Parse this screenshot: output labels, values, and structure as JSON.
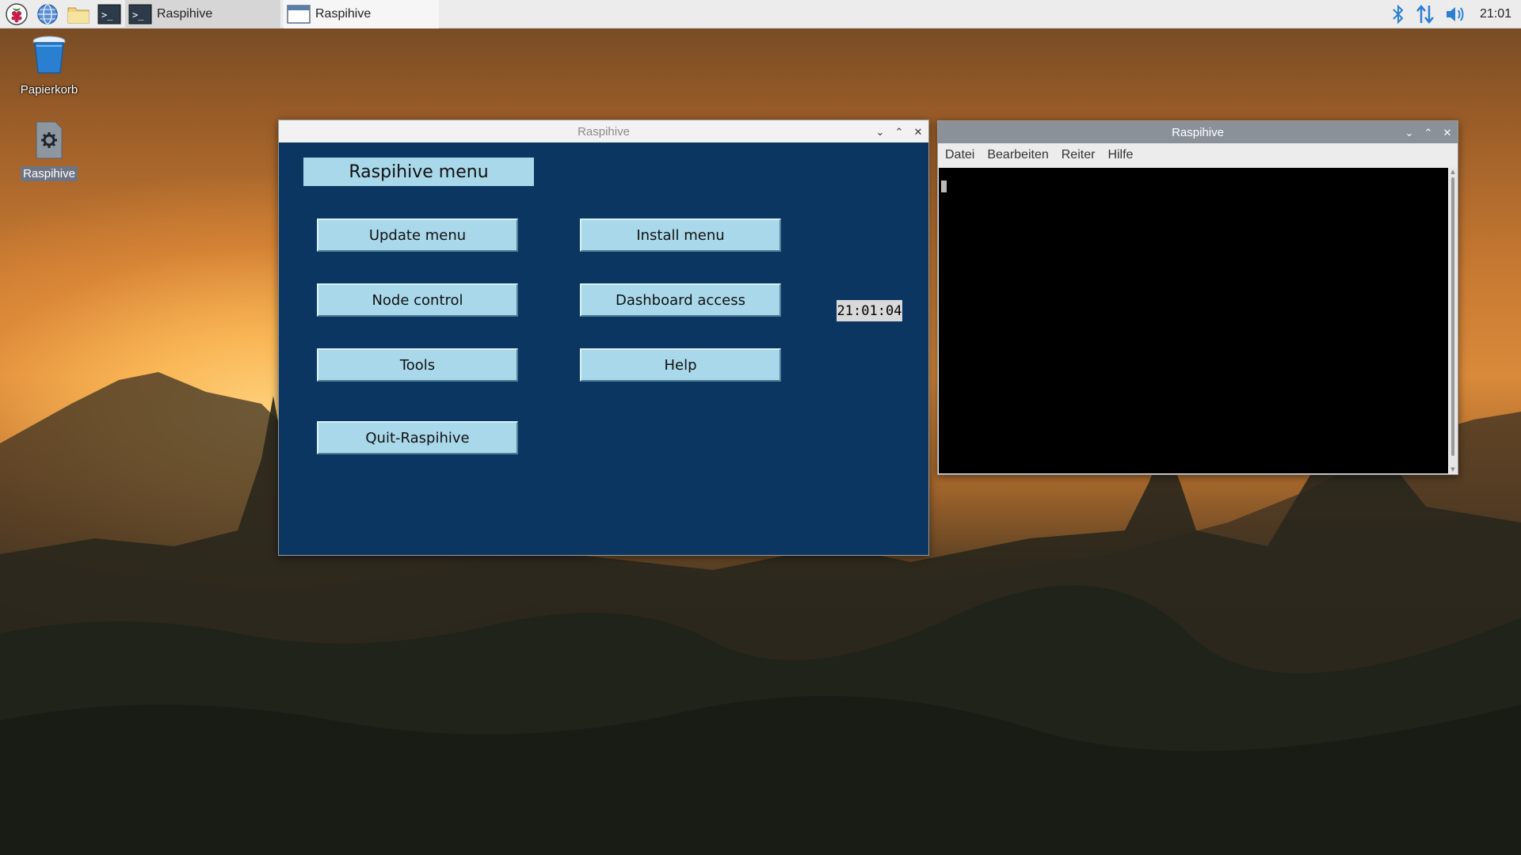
{
  "taskbar": {
    "launchers": [
      {
        "name": "raspberry-menu-icon"
      },
      {
        "name": "web-browser-icon"
      },
      {
        "name": "file-manager-icon"
      },
      {
        "name": "terminal-icon"
      }
    ],
    "tasks": [
      {
        "label": "Raspihive",
        "icon": "terminal-icon",
        "active": false
      },
      {
        "label": "Raspihive",
        "icon": "window-icon",
        "active": true
      }
    ],
    "tray": {
      "icons": [
        "bluetooth-icon",
        "network-icon",
        "volume-icon"
      ],
      "clock": "21:01"
    }
  },
  "desktop": {
    "icons": [
      {
        "label": "Papierkorb",
        "icon": "trash-icon",
        "selected": false
      },
      {
        "label": "Raspihive",
        "icon": "gear-file-icon",
        "selected": true
      }
    ]
  },
  "menu_window": {
    "title": "Raspihive",
    "heading": "Raspihive menu",
    "buttons": {
      "update": "Update menu",
      "install": "Install menu",
      "node_control": "Node control",
      "dashboard": "Dashboard access",
      "tools": "Tools",
      "help": "Help",
      "quit": "Quit-Raspihive"
    },
    "clock": "21:01:04",
    "colors": {
      "background": "#0b3662",
      "button": "#a9d8ea"
    }
  },
  "terminal_window": {
    "title": "Raspihive",
    "menu": {
      "file": "Datei",
      "edit": "Bearbeiten",
      "tabs": "Reiter",
      "help": "Hilfe"
    }
  }
}
